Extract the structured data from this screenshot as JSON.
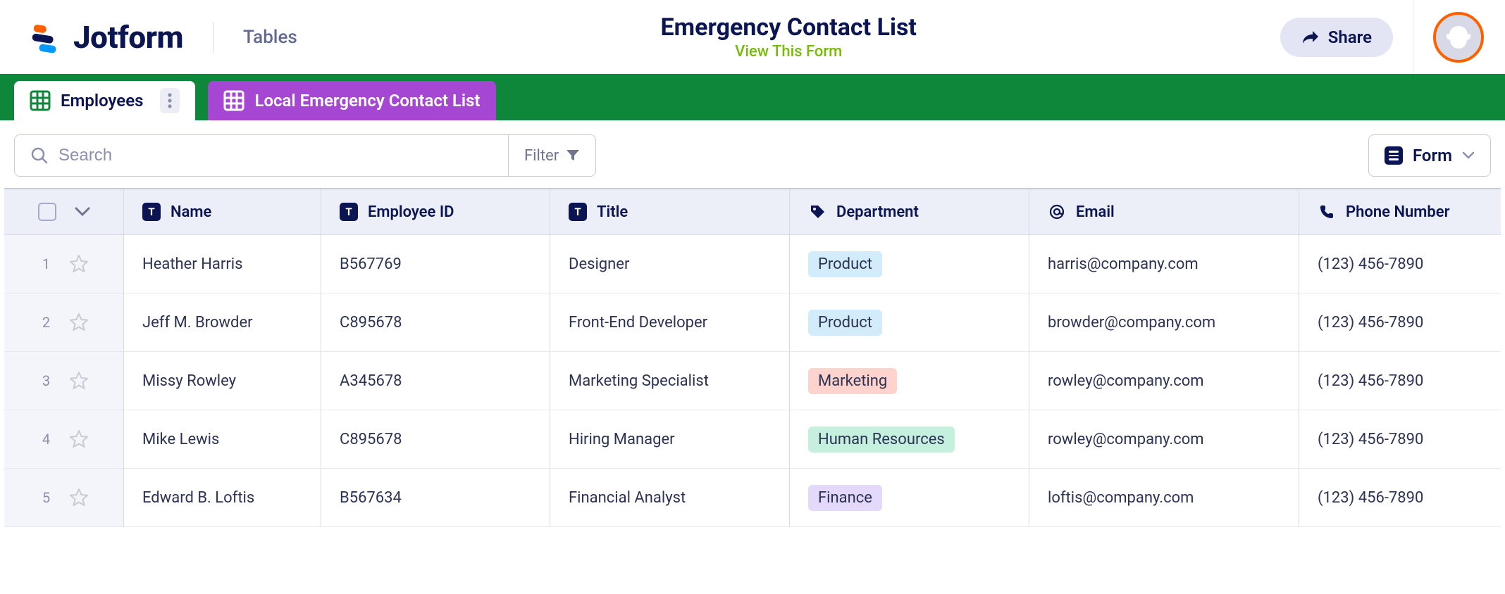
{
  "header": {
    "brand": "Jotform",
    "section": "Tables",
    "title": "Emergency Contact List",
    "view_link": "View This Form",
    "share_label": "Share"
  },
  "tabs": [
    {
      "label": "Employees"
    },
    {
      "label": "Local Emergency Contact List"
    }
  ],
  "toolbar": {
    "search_placeholder": "Search",
    "filter_label": "Filter",
    "form_label": "Form"
  },
  "columns": {
    "name": "Name",
    "id": "Employee ID",
    "title": "Title",
    "dept": "Department",
    "email": "Email",
    "phone": "Phone Number"
  },
  "rows": [
    {
      "num": "1",
      "name": "Heather Harris",
      "id": "B567769",
      "title": "Designer",
      "dept": "Product",
      "dept_class": "dept-product",
      "email": "harris@company.com",
      "phone": "(123) 456-7890"
    },
    {
      "num": "2",
      "name": "Jeff M. Browder",
      "id": "C895678",
      "title": "Front-End Developer",
      "dept": "Product",
      "dept_class": "dept-product",
      "email": "browder@company.com",
      "phone": "(123) 456-7890"
    },
    {
      "num": "3",
      "name": "Missy Rowley",
      "id": "A345678",
      "title": "Marketing Specialist",
      "dept": "Marketing",
      "dept_class": "dept-marketing",
      "email": "rowley@company.com",
      "phone": "(123) 456-7890"
    },
    {
      "num": "4",
      "name": "Mike Lewis",
      "id": "C895678",
      "title": "Hiring Manager",
      "dept": "Human Resources",
      "dept_class": "dept-hr",
      "email": "rowley@company.com",
      "phone": "(123) 456-7890"
    },
    {
      "num": "5",
      "name": "Edward B. Loftis",
      "id": "B567634",
      "title": "Financial Analyst",
      "dept": "Finance",
      "dept_class": "dept-finance",
      "email": "loftis@company.com",
      "phone": "(123) 456-7890"
    }
  ]
}
